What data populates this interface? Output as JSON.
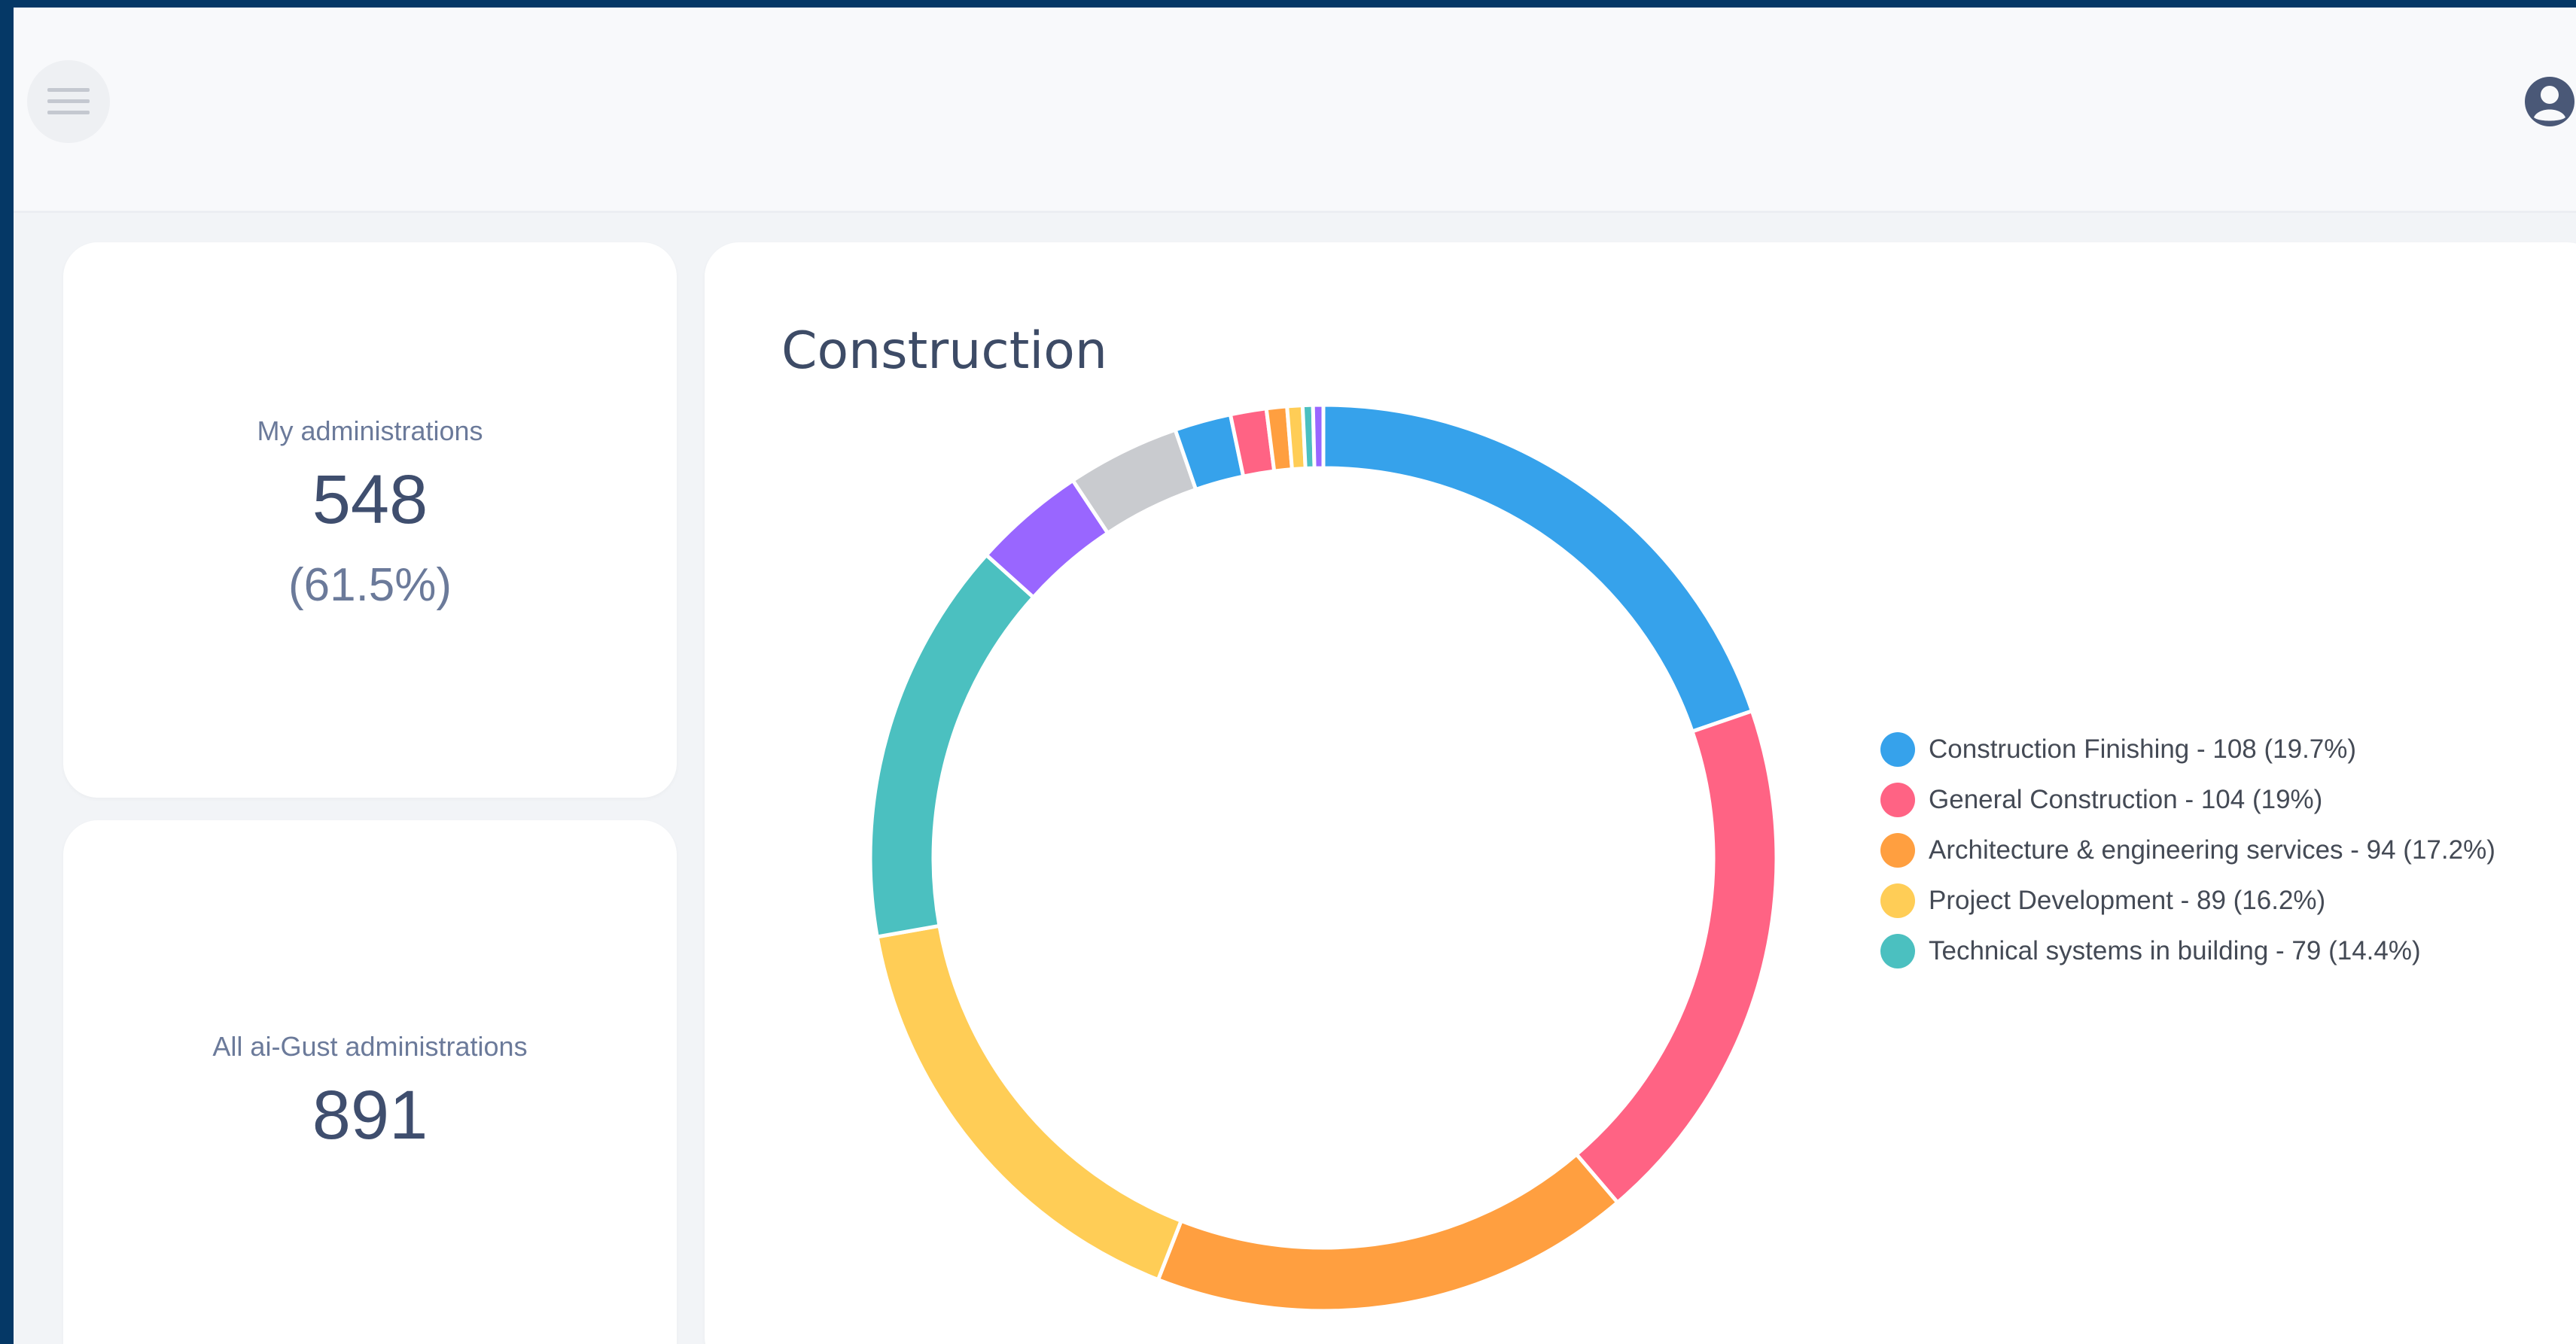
{
  "stats": {
    "my_admin": {
      "label": "My administrations",
      "value": "548",
      "percent": "(61.5%)"
    },
    "all_admin": {
      "label": "All ai-Gust administrations",
      "value": "891"
    }
  },
  "header": {
    "menu_icon": "hamburger-icon",
    "user_icon": "user-circle-icon"
  },
  "chart_title": "Construction",
  "chart_data": {
    "type": "pie",
    "title": "Construction",
    "legend_position": "right",
    "labels": [
      "Construction Finishing",
      "General Construction",
      "Architecture & engineering services",
      "Project Development",
      "Technical systems in building",
      "",
      "",
      "",
      "",
      "",
      "",
      "",
      ""
    ],
    "values": [
      108,
      104,
      94,
      89,
      79,
      22,
      22,
      11,
      7,
      4,
      3,
      2,
      2
    ],
    "colors": [
      "#36a2eb",
      "#ff6384",
      "#ff9f40",
      "#ffcd56",
      "#4bc0c0",
      "#9966ff",
      "#c9cbcf",
      "#36a2eb",
      "#ff6384",
      "#ff9f40",
      "#ffcd56",
      "#4bc0c0",
      "#9966ff"
    ],
    "legend": [
      {
        "text": "Construction Finishing - 108 (19.7%)",
        "color": "#36a2eb"
      },
      {
        "text": "General Construction - 104 (19%)",
        "color": "#ff6384"
      },
      {
        "text": "Architecture & engineering services - 94 (17.2%)",
        "color": "#ff9f40"
      },
      {
        "text": "Project Development - 89 (16.2%)",
        "color": "#ffcd56"
      },
      {
        "text": "Technical systems in building - 79 (14.4%)",
        "color": "#4bc0c0"
      }
    ]
  }
}
